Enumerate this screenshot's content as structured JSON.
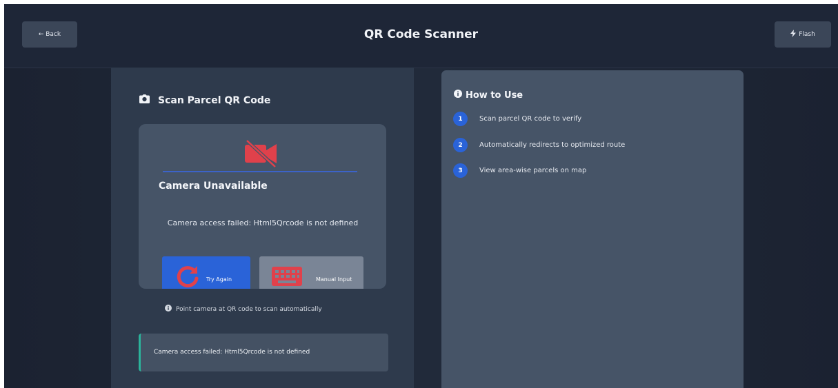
{
  "header": {
    "back_label": "← Back",
    "title": "QR Code Scanner",
    "flash_label": "Flash"
  },
  "scanner": {
    "heading": "Scan Parcel QR Code",
    "status_title": "Camera Unavailable",
    "status_message": "Camera access failed: Html5Qrcode is not defined",
    "try_again_label": "Try Again",
    "manual_input_label": "Manual Input",
    "hint": "Point camera at QR code to scan automatically",
    "error_message": "Camera access failed: Html5Qrcode is not defined"
  },
  "help": {
    "title": "How to Use",
    "steps": [
      {
        "num": "1",
        "text": "Scan parcel QR code to verify"
      },
      {
        "num": "2",
        "text": "Automatically redirects to optimized route"
      },
      {
        "num": "3",
        "text": "View area-wise parcels on map"
      }
    ]
  },
  "colors": {
    "accent": "#2a63d8",
    "danger": "#e0414b",
    "success_border": "#2bb39b",
    "panel": "#465467",
    "background": "#1b2231"
  },
  "icons": {
    "flash": "bolt-icon",
    "scan_heading": "camera-icon",
    "camera_status": "camera-off-icon",
    "try_again": "refresh-icon",
    "manual_input": "keyboard-icon",
    "info": "info-icon"
  }
}
